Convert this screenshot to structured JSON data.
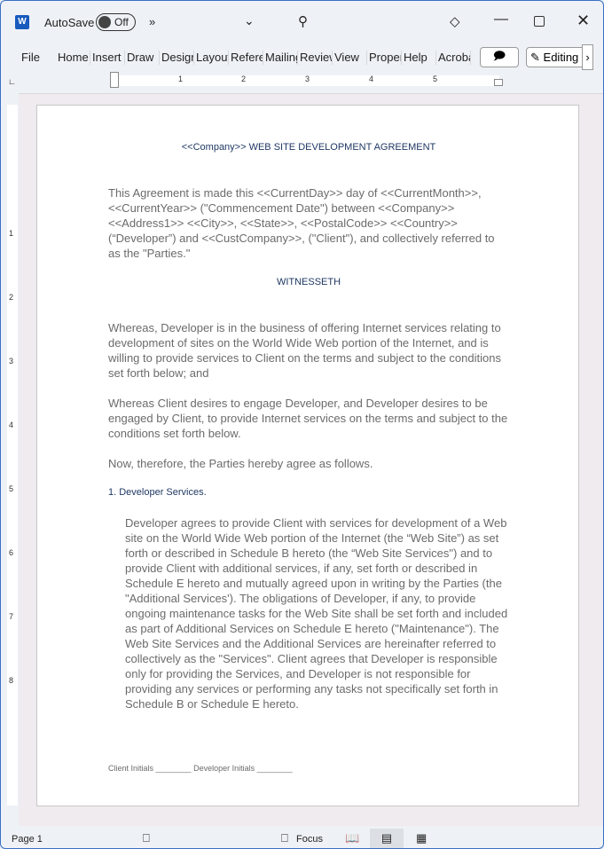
{
  "titlebar": {
    "autosave_label": "AutoSave",
    "autosave_state": "Off",
    "more": "»"
  },
  "ribbon": {
    "tabs": [
      "File",
      "Home",
      "Insert",
      "Draw",
      "Design",
      "Layout",
      "References",
      "Mailings",
      "Review",
      "View",
      "Properties",
      "Help",
      "Acrobat"
    ],
    "editing_label": "Editing"
  },
  "ruler": {
    "numbers": [
      "1",
      "2",
      "3",
      "4",
      "5"
    ],
    "vnumbers": [
      "1",
      "2",
      "3",
      "4",
      "5",
      "6",
      "7",
      "8"
    ]
  },
  "document": {
    "title": "<<Company>> WEB SITE DEVELOPMENT AGREEMENT",
    "intro": "This Agreement is made this <<CurrentDay>> day of <<CurrentMonth>>, <<CurrentYear>> (\"Commencement Date\") between <<Company>> <<Address1>> <<City>>, <<State>>, <<PostalCode>> <<Country>> (“Developer”) and <<CustCompany>>, (\"Client\"), and collectively referred to as the \"Parties.\"",
    "witnesseth": "WITNESSETH",
    "whereas1": "Whereas, Developer is in the business of offering Internet services relating to development of sites on the World Wide Web portion of the Internet, and is willing to provide services to Client on the terms and subject to the conditions set forth below; and",
    "whereas2": "Whereas Client desires to engage Developer, and Developer desires to be engaged by Client, to provide Internet services on the terms and subject to the conditions set forth below.",
    "now": "Now, therefore, the Parties hereby agree as follows.",
    "section1": "1. Developer Services.",
    "section1_body": "Developer agrees to provide Client with services for development of a Web site on the World Wide Web portion of the Internet (the “Web Site”) as set forth or described in Schedule B hereto (the “Web Site Services\") and to provide Client with additional services, if any, set forth or described in Schedule E hereto and mutually agreed upon in writing by the Parties (the \"Additional Services'). The obligations of Developer, if any, to provide ongoing maintenance tasks for the Web Site shall be set forth and included as part of Additional Services on Schedule E hereto (\"Maintenance\").  The Web Site Services and the Additional Services are hereinafter referred to collectively as the \"Services\". Client agrees that Developer is responsible only for providing the Services, and Developer is not responsible for providing any services or performing any tasks not specifically set forth in Schedule B or Schedule E hereto.",
    "footer": "Client Initials  ________ Developer Initials ________"
  },
  "status": {
    "page": "Page 1",
    "focus": "Focus"
  }
}
